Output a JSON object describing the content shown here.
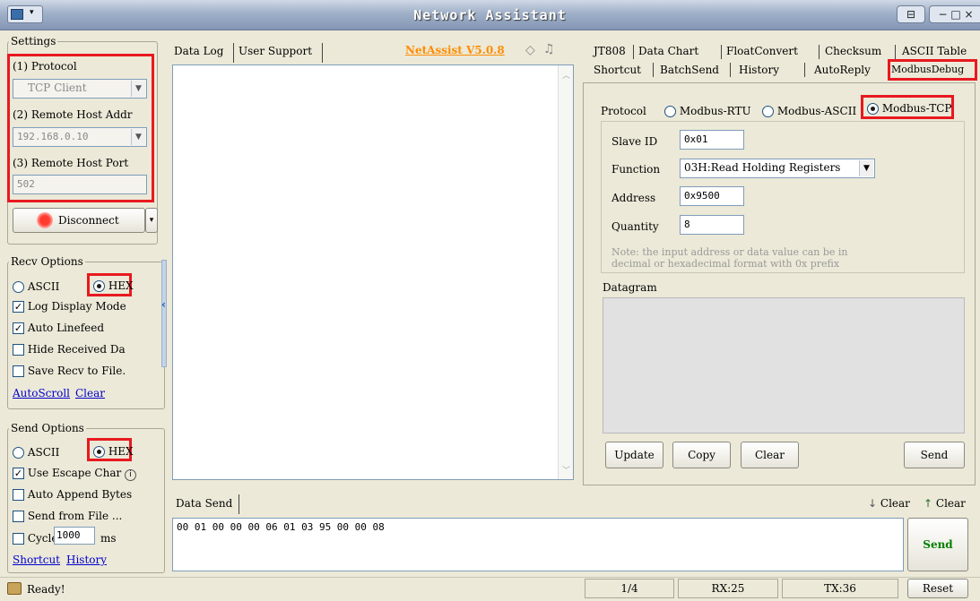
{
  "window": {
    "title": "Network Assistant",
    "controls": [
      "▢",
      "− □"
    ]
  },
  "settings": {
    "group_label": "Settings",
    "protocol_label": "(1) Protocol",
    "protocol_value": "TCP Client",
    "remote_addr_label": "(2) Remote Host Addr",
    "remote_addr_value": "192.168.0.10",
    "remote_port_label": "(3) Remote Host Port",
    "remote_port_value": "502",
    "disconnect_label": "Disconnect"
  },
  "recv_options": {
    "group_label": "Recv Options",
    "ascii": "ASCII",
    "hex": "HEX",
    "log_display": "Log Display Mode",
    "auto_linefeed": "Auto Linefeed",
    "hide_received": "Hide Received Da",
    "save_recv": "Save Recv to File.",
    "autoscroll": "AutoScroll",
    "clear": "Clear"
  },
  "send_options": {
    "group_label": "Send Options",
    "ascii": "ASCII",
    "hex": "HEX",
    "use_escape": "Use Escape Char",
    "auto_append": "Auto Append Bytes",
    "send_from_file": "Send from File ...",
    "cycle": "Cycle",
    "cycle_value": "1000",
    "cycle_unit": "ms",
    "shortcut": "Shortcut",
    "history": "History"
  },
  "center": {
    "tab_data_log": "Data Log",
    "tab_user_support": "User Support",
    "version": "NetAssist V5.0.8",
    "data_send_label": "Data Send",
    "clear1": "Clear",
    "clear2": "Clear",
    "send_data": "00 01 00 00 00 06 01 03 95 00 00 08",
    "send_button": "Send"
  },
  "right": {
    "tabs_row1": [
      "JT808",
      "Data Chart",
      "FloatConvert",
      "Checksum",
      "ASCII Table"
    ],
    "tabs_row2": [
      "Shortcut",
      "BatchSend",
      "History",
      "AutoReply",
      "ModbusDebug"
    ],
    "protocol_label": "Protocol",
    "modbus_rtu": "Modbus-RTU",
    "modbus_ascii": "Modbus-ASCII",
    "modbus_tcp": "Modbus-TCP",
    "slave_id_label": "Slave ID",
    "slave_id_value": "0x01",
    "function_label": "Function",
    "function_value": "03H:Read Holding Registers",
    "address_label": "Address",
    "address_value": "0x9500",
    "quantity_label": "Quantity",
    "quantity_value": "8",
    "note_line1": "Note: the input address or data value can be in",
    "note_line2": "decimal or hexadecimal format with  0x prefix",
    "datagram_label": "Datagram",
    "update": "Update",
    "copy": "Copy",
    "clear": "Clear",
    "send": "Send"
  },
  "status": {
    "ready": "Ready!",
    "page": "1/4",
    "rx": "RX:25",
    "tx": "TX:36",
    "reset": "Reset"
  },
  "colors": {
    "highlight": "#e8191f",
    "version": "#ff8c00",
    "send_green": "#008000",
    "link": "#0000cc"
  }
}
